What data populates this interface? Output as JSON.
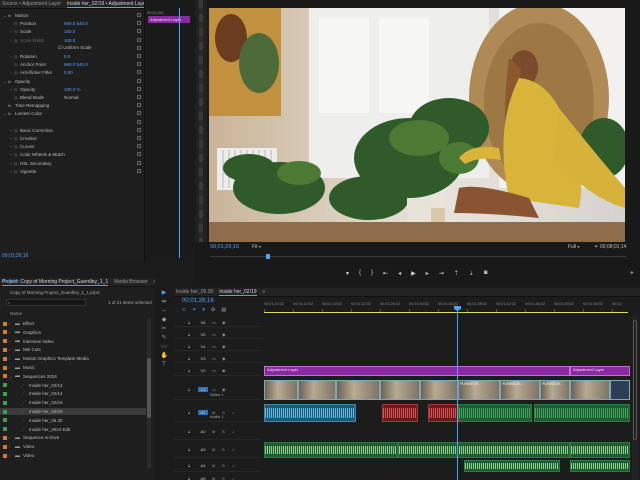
{
  "effect_controls": {
    "tabs": [
      {
        "label": "Source • Adjustment Layer",
        "active": false
      },
      {
        "label": "Inside her_02/19 • Adjustment Layer",
        "active": true
      }
    ],
    "ruler_time": "00;01;26;",
    "clip_label": "Adjustment Layer",
    "rows": [
      {
        "indent": 0,
        "tw": "⌄",
        "label": "Motion",
        "value": ""
      },
      {
        "indent": 1,
        "tw": "",
        "label": "Position",
        "value": "960.0    540.0"
      },
      {
        "indent": 1,
        "tw": "›",
        "label": "Scale",
        "value": "100.0"
      },
      {
        "indent": 1,
        "tw": "›",
        "label": "Scale Width",
        "value": "100.0",
        "dim": true
      },
      {
        "indent": 1,
        "tw": "",
        "label": "",
        "value": "☑ Uniform Scale"
      },
      {
        "indent": 1,
        "tw": "›",
        "label": "Rotation",
        "value": "0.0"
      },
      {
        "indent": 1,
        "tw": "",
        "label": "Anchor Point",
        "value": "960.0    540.0"
      },
      {
        "indent": 1,
        "tw": "›",
        "label": "Anti-flicker Filter",
        "value": "0.00"
      },
      {
        "indent": 0,
        "tw": "⌄",
        "label": "Opacity",
        "value": ""
      },
      {
        "indent": 1,
        "tw": "›",
        "label": "Opacity",
        "value": "100.0 %"
      },
      {
        "indent": 1,
        "tw": "",
        "label": "Blend Mode",
        "value": "Normal"
      },
      {
        "indent": 0,
        "tw": "",
        "label": "Time Remapping",
        "value": ""
      },
      {
        "indent": 0,
        "tw": "⌄",
        "label": "Lumetri Color",
        "value": ""
      },
      {
        "indent": 1,
        "tw": "",
        "label": "",
        "value": ""
      },
      {
        "indent": 1,
        "tw": "›",
        "label": "Basic Correction",
        "value": ""
      },
      {
        "indent": 1,
        "tw": "›",
        "label": "Creative",
        "value": ""
      },
      {
        "indent": 1,
        "tw": "›",
        "label": "Curves",
        "value": ""
      },
      {
        "indent": 1,
        "tw": "›",
        "label": "Color Wheels & Match",
        "value": ""
      },
      {
        "indent": 1,
        "tw": "›",
        "label": "HSL Secondary",
        "value": ""
      },
      {
        "indent": 1,
        "tw": "›",
        "label": "Vignette",
        "value": ""
      }
    ],
    "bottom_time": "00;01;26;16"
  },
  "program": {
    "timecode": "00;01;26;16",
    "fit": "Fit",
    "quality": "Full",
    "duration": "00;08;01;14",
    "colors": {
      "accent": "#4ea2ff"
    }
  },
  "project": {
    "tabs": [
      {
        "label": "Project: Copy of Morning Project_Guerdley_1_1",
        "active": true
      },
      {
        "label": "Media Browser",
        "active": false
      }
    ],
    "file": "Copy of Morning Project_Guerdley_1_1.prproj",
    "selection": "1 of 21 items selected",
    "column": "Name",
    "items": [
      {
        "indent": 0,
        "type": "folder",
        "color": "#d97a2b",
        "label": "Effect"
      },
      {
        "indent": 0,
        "type": "folder",
        "color": "#d97a2b",
        "label": "Graphics"
      },
      {
        "indent": 0,
        "type": "folder",
        "color": "#d97a2b",
        "label": "Interview Video"
      },
      {
        "indent": 0,
        "type": "folder",
        "color": "#d97a2b",
        "label": "Mel Cuts"
      },
      {
        "indent": 0,
        "type": "folder",
        "color": "#d97a2b",
        "label": "Motion Graphics Template Media"
      },
      {
        "indent": 0,
        "type": "folder",
        "color": "#d97a2b",
        "label": "Music"
      },
      {
        "indent": 0,
        "type": "folder",
        "color": "#d97a2b",
        "label": "Sequences 2024",
        "open": true
      },
      {
        "indent": 1,
        "type": "seq",
        "color": "#3aa34d",
        "label": "Inside her_02/12"
      },
      {
        "indent": 1,
        "type": "seq",
        "color": "#3aa34d",
        "label": "Inside her_02/14"
      },
      {
        "indent": 1,
        "type": "seq",
        "color": "#3aa34d",
        "label": "Inside her_02/16"
      },
      {
        "indent": 1,
        "type": "seq",
        "color": "#3aa34d",
        "label": "Inside her_02/19",
        "selected": true
      },
      {
        "indent": 1,
        "type": "seq",
        "color": "#3aa34d",
        "label": "Inside her_05.30"
      },
      {
        "indent": 1,
        "type": "seq",
        "color": "#3aa34d",
        "label": "Inside her_2024 Edit"
      },
      {
        "indent": 0,
        "type": "folder",
        "color": "#d97a2b",
        "label": "Sequence Archive"
      },
      {
        "indent": 0,
        "type": "folder",
        "color": "#d97a2b",
        "label": "Video"
      },
      {
        "indent": 0,
        "type": "folder",
        "color": "#d97a2b",
        "label": "Video"
      }
    ],
    "top_time": "00;01;26;"
  },
  "timeline": {
    "tabs": [
      {
        "label": "Inside her_05.30",
        "active": false
      },
      {
        "label": "Inside her_02/19",
        "active": true
      }
    ],
    "timecode": "00;01;26;16",
    "ruler": [
      "00;01;10;02",
      "00;01;14;02",
      "00;01;18;02",
      "00;01;22;02",
      "00;01;26;02",
      "00;01;30;02",
      "00;01;34;02",
      "00;01;38;02",
      "00;01;42;02",
      "00;01;46;02",
      "00;01;50;02",
      "00;01;54;02",
      "00;02"
    ],
    "tracks": [
      "V6",
      "V5",
      "V4",
      "V3",
      "V2",
      "V1",
      "A1",
      "A2",
      "A3",
      "A4",
      "A5",
      "A6"
    ],
    "video1_label": "Video 1",
    "audio1_label": "Audio 1",
    "adjustment_label": "Adjustment Layer",
    "adjustment_label2": "Adjustment Layer",
    "clip_labels": [
      "PUWBEDE...",
      "PUWBEDE...",
      "PUWBEDE..."
    ],
    "tools": [
      "▶",
      "⇹",
      "⇔",
      "◆",
      "✂",
      "✎",
      "▭",
      "✋",
      "T"
    ]
  }
}
